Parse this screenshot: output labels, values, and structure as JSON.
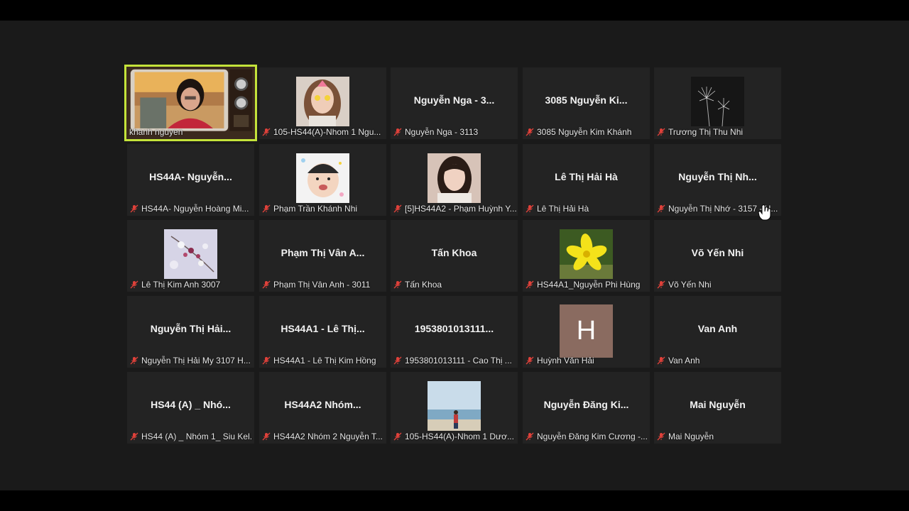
{
  "tiles": [
    {
      "name": "khanh nguyen",
      "label": "khanh nguyen",
      "kind": "video",
      "muted": false,
      "active": true
    },
    {
      "name": "105-HS44(A)-Nhom 1 Ngu...",
      "label": "105-HS44(A)-Nhom 1 Ngu...",
      "kind": "photo-girl-filter",
      "muted": true
    },
    {
      "name": "Nguyễn Nga - 3...",
      "label": "Nguyễn Nga - 3113",
      "kind": "text",
      "muted": true
    },
    {
      "name": "3085 Nguyễn Ki...",
      "label": "3085 Nguyễn Kim Khánh",
      "kind": "text",
      "muted": true
    },
    {
      "name": "Trương Thị Thu Nhi",
      "label": "Trương Thị Thu Nhi",
      "kind": "photo-dandelion",
      "muted": true
    },
    {
      "name": "HS44A- Nguyễn...",
      "label": "HS44A- Nguyễn Hoàng Mi...",
      "kind": "text",
      "muted": true
    },
    {
      "name": "Phạm Trần Khánh Nhi",
      "label": "Phạm Trần Khánh Nhi",
      "kind": "photo-child",
      "muted": true
    },
    {
      "name": "[5]HS44A2 - Phạm Huỳnh Y...",
      "label": "[5]HS44A2 - Phạm Huỳnh Y...",
      "kind": "photo-girl",
      "muted": true
    },
    {
      "name": "Lê Thị Hải Hà",
      "label": "Lê Thị Hải Hà",
      "kind": "text",
      "muted": true
    },
    {
      "name": "Nguyễn Thị Nh...",
      "label": "Nguyễn Thị Nhớ - 3157 - H...",
      "kind": "text",
      "muted": true
    },
    {
      "name": "Lê Thị Kim Anh 3007",
      "label": "Lê Thị Kim Anh 3007",
      "kind": "photo-blossom",
      "muted": true
    },
    {
      "name": "Phạm Thị Vân A...",
      "label": "Phạm Thị Vân Anh - 3011",
      "kind": "text",
      "muted": true
    },
    {
      "name": "Tấn Khoa",
      "label": "Tấn Khoa",
      "kind": "text",
      "muted": true
    },
    {
      "name": "HS44A1_Nguyễn Phi Hùng",
      "label": "HS44A1_Nguyễn Phi Hùng",
      "kind": "photo-flower",
      "muted": true
    },
    {
      "name": "Võ Yến Nhi",
      "label": "Võ Yến Nhi",
      "kind": "text",
      "muted": true
    },
    {
      "name": "Nguyễn Thị Hải...",
      "label": "Nguyễn Thị Hải My 3107 H...",
      "kind": "text",
      "muted": true
    },
    {
      "name": "HS44A1 - Lê Thị...",
      "label": "HS44A1 - Lê Thị Kim Hồng",
      "kind": "text",
      "muted": true
    },
    {
      "name": "1953801013111...",
      "label": "1953801013111 - Cao Thị ...",
      "kind": "text",
      "muted": true
    },
    {
      "name": "Huỳnh Văn Hải",
      "label": "Huỳnh Văn Hải",
      "kind": "avatar",
      "avatar_letter": "H",
      "muted": true
    },
    {
      "name": "Van Anh",
      "label": "Van Anh",
      "kind": "text",
      "muted": true
    },
    {
      "name": "HS44 (A) _ Nhó...",
      "label": "HS44 (A) _ Nhóm 1_ Siu Kel...",
      "kind": "text",
      "muted": true
    },
    {
      "name": "HS44A2 Nhóm...",
      "label": "HS44A2 Nhóm 2 Nguyễn T...",
      "kind": "text",
      "muted": true
    },
    {
      "name": "105-HS44(A)-Nhom 1 Dươ...",
      "label": "105-HS44(A)-Nhom 1 Dươ...",
      "kind": "photo-beach",
      "muted": true
    },
    {
      "name": "Nguyễn Đăng Ki...",
      "label": "Nguyễn Đăng Kim Cương -...",
      "kind": "text",
      "muted": true
    },
    {
      "name": "Mai Nguyễn",
      "label": "Mai Nguyễn",
      "kind": "text",
      "muted": true
    }
  ],
  "colors": {
    "active_border": "#c4e33a",
    "muted_mic": "#e0413a",
    "tile_bg": "#232323",
    "stage_bg": "#1a1a1a"
  },
  "icons": {
    "muted": "microphone-muted-icon",
    "cursor": "hand-cursor-icon"
  }
}
